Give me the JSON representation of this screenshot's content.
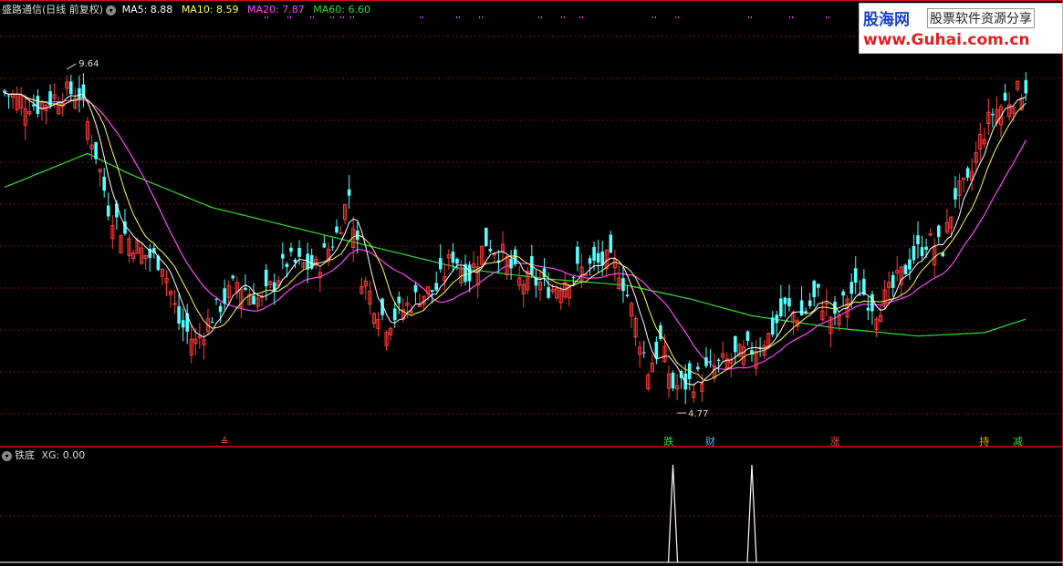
{
  "header": {
    "title": "盛路通信(日线 前复权)",
    "ma5_label": "MA5: 8.88",
    "ma10_label": "MA10: 8.59",
    "ma20_label": "MA20: 7.87",
    "ma60_label": "MA60: 6.60",
    "toggle_glyph": "▾"
  },
  "indicator_header": {
    "name": "铁底",
    "xg_label": "XG: 0.00",
    "toggle_glyph": "▾"
  },
  "logo": {
    "brand_cn": "股海网",
    "brand_sub": "股票软件资源分享",
    "url": "www.Guhai.com.cn"
  },
  "colors": {
    "up": "#ff3a3a",
    "down": "#54ffff",
    "ma5": "#ffffff",
    "ma10": "#ffff55",
    "ma20": "#ff44ff",
    "ma60": "#33dd33",
    "grid": "#7a1010",
    "label_green": "#33dd33",
    "label_cyan": "#55aaff",
    "label_red": "#ff4444",
    "label_yellow": "#ffaa00"
  },
  "chart_data": {
    "type": "candlestick",
    "price_range": [
      4.2,
      10.4
    ],
    "high_marker": {
      "index": 15,
      "label": "9.64"
    },
    "low_marker": {
      "index": 162,
      "label": "4.77"
    },
    "event_labels": [
      {
        "index": 53,
        "text": "≙",
        "color_key": "label_red"
      },
      {
        "index": 160,
        "text": "跌",
        "color_key": "label_green"
      },
      {
        "index": 170,
        "text": "财",
        "color_key": "label_cyan"
      },
      {
        "index": 200,
        "text": "涨",
        "color_key": "label_red"
      },
      {
        "index": 236,
        "text": "持",
        "color_key": "label_yellow"
      },
      {
        "index": 244,
        "text": "减",
        "color_key": "label_green"
      }
    ],
    "signal_spikes_index": [
      161,
      180
    ],
    "anchors": [
      [
        0,
        9.3
      ],
      [
        8,
        9.1
      ],
      [
        14,
        9.3
      ],
      [
        18,
        9.3
      ],
      [
        22,
        8.4
      ],
      [
        25,
        7.6
      ],
      [
        29,
        7.2
      ],
      [
        34,
        6.9
      ],
      [
        38,
        6.8
      ],
      [
        42,
        5.9
      ],
      [
        46,
        5.6
      ],
      [
        50,
        6.0
      ],
      [
        56,
        6.5
      ],
      [
        62,
        6.2
      ],
      [
        68,
        6.8
      ],
      [
        75,
        6.7
      ],
      [
        80,
        7.2
      ],
      [
        83,
        7.8
      ],
      [
        86,
        6.6
      ],
      [
        89,
        6.2
      ],
      [
        92,
        5.9
      ],
      [
        96,
        6.1
      ],
      [
        100,
        6.3
      ],
      [
        104,
        6.4
      ],
      [
        108,
        6.9
      ],
      [
        112,
        6.6
      ],
      [
        116,
        7.1
      ],
      [
        120,
        6.9
      ],
      [
        124,
        6.5
      ],
      [
        128,
        6.5
      ],
      [
        132,
        6.4
      ],
      [
        136,
        6.6
      ],
      [
        140,
        6.7
      ],
      [
        145,
        6.8
      ],
      [
        148,
        6.7
      ],
      [
        152,
        5.9
      ],
      [
        155,
        5.2
      ],
      [
        158,
        5.6
      ],
      [
        161,
        4.95
      ],
      [
        165,
        5.0
      ],
      [
        170,
        5.2
      ],
      [
        175,
        5.35
      ],
      [
        180,
        5.5
      ],
      [
        184,
        5.7
      ],
      [
        188,
        6.1
      ],
      [
        192,
        6.0
      ],
      [
        196,
        6.3
      ],
      [
        200,
        5.9
      ],
      [
        203,
        6.3
      ],
      [
        206,
        6.4
      ],
      [
        210,
        6.1
      ],
      [
        214,
        6.4
      ],
      [
        218,
        6.8
      ],
      [
        222,
        7.1
      ],
      [
        226,
        7.0
      ],
      [
        229,
        7.8
      ],
      [
        232,
        7.9
      ],
      [
        235,
        8.6
      ],
      [
        238,
        9.0
      ],
      [
        242,
        9.2
      ],
      [
        246,
        9.4
      ]
    ],
    "ma60_anchors": [
      [
        0,
        7.9
      ],
      [
        20,
        8.4
      ],
      [
        30,
        8.1
      ],
      [
        50,
        7.6
      ],
      [
        70,
        7.3
      ],
      [
        90,
        7.0
      ],
      [
        110,
        6.7
      ],
      [
        130,
        6.55
      ],
      [
        150,
        6.45
      ],
      [
        165,
        6.25
      ],
      [
        180,
        6.0
      ],
      [
        200,
        5.82
      ],
      [
        220,
        5.7
      ],
      [
        236,
        5.75
      ],
      [
        246,
        5.95
      ]
    ],
    "indicator": {
      "name": "铁底",
      "xg_range": [
        0,
        1
      ]
    }
  }
}
